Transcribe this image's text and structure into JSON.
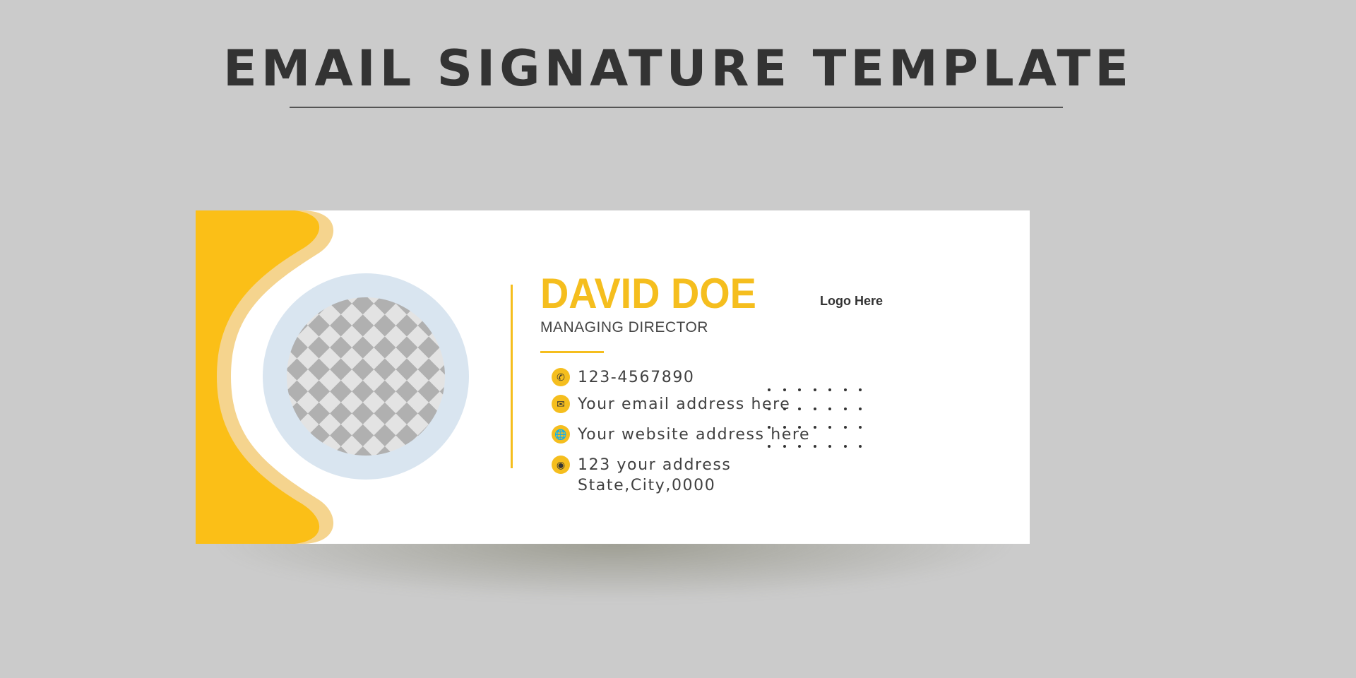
{
  "header": {
    "title": "EMAIL SIGNATURE TEMPLATE"
  },
  "signature": {
    "name": "DAVID DOE",
    "role": "MANAGING DIRECTOR",
    "logo": "Logo Here",
    "contacts": [
      {
        "icon": "phone-icon",
        "lines": [
          "123-4567890"
        ]
      },
      {
        "icon": "email-icon",
        "lines": [
          "Your email address here"
        ]
      },
      {
        "icon": "globe-icon",
        "lines": [
          "Your website address here"
        ]
      },
      {
        "icon": "location-pin-icon",
        "lines": [
          "123 your address",
          "State,City,0000"
        ]
      }
    ]
  },
  "colors": {
    "accent": "#F5BE1E",
    "accent_light": "#F5D48E",
    "photo_ring": "#D9E5F0",
    "background": "#CBCBCB",
    "text": "#333333"
  }
}
